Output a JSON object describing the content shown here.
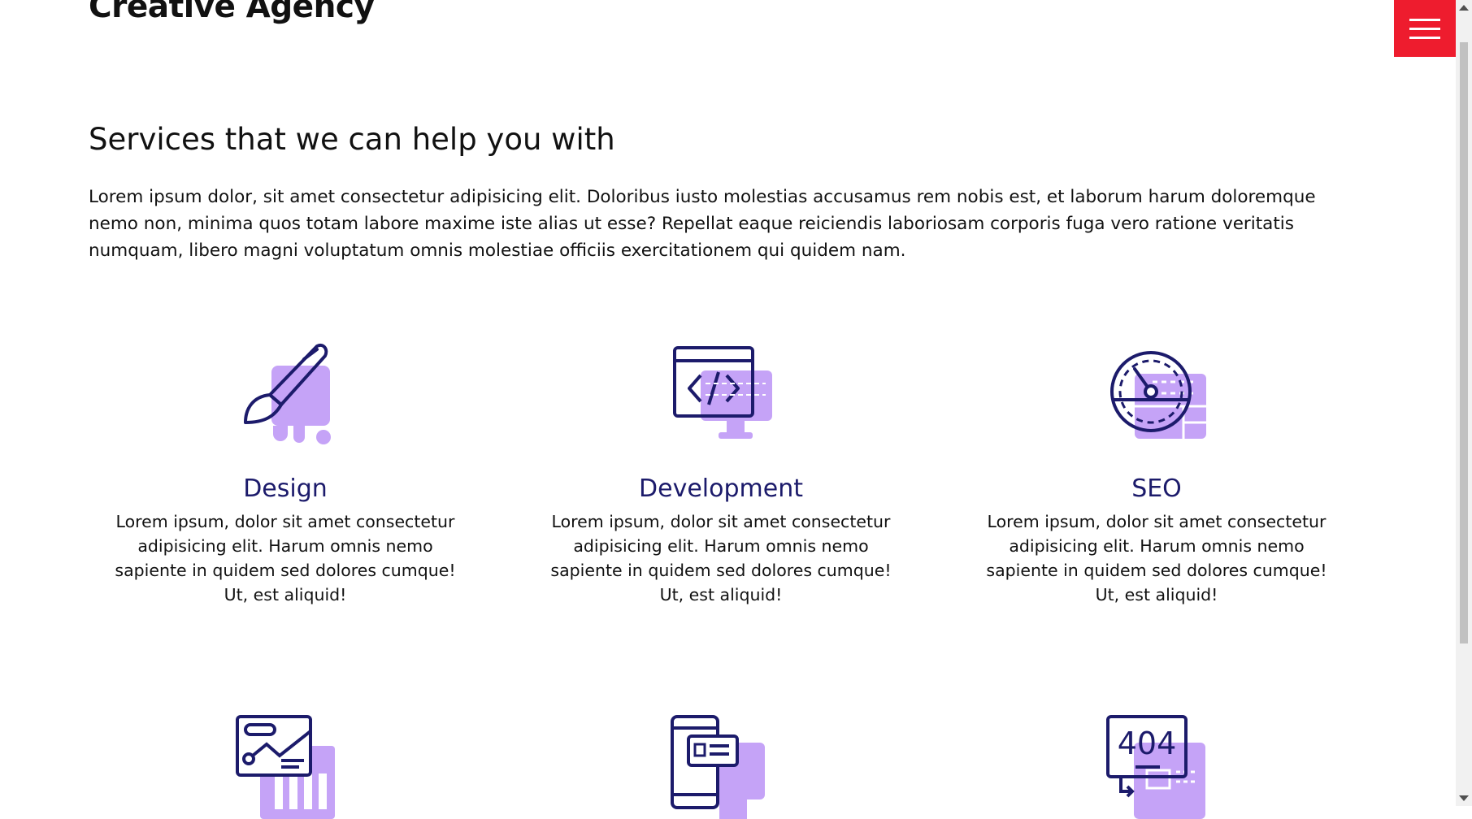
{
  "header": {
    "brand": "Creative Agency",
    "menu_icon": "hamburger-menu-icon",
    "menu_color": "#ee1c2e"
  },
  "intro": {
    "title": "Services that we can help you with",
    "text": "Lorem ipsum dolor, sit amet consectetur adipisicing elit. Doloribus iusto molestias accusamus rem nobis est, et laborum harum doloremque nemo non, minima quos totam labore maxime iste alias ut esse? Repellat eaque reiciendis laboriosam corporis fuga vero ratione veritatis numquam, libero magni voluptatum omnis molestiae officiis exercitationem qui quidem nam."
  },
  "colors": {
    "icon_outline": "#1c1b6b",
    "icon_fill": "#c5a3f7",
    "heading": "#1c1b6b"
  },
  "services": [
    {
      "icon": "paintbrush-icon",
      "title": "Design",
      "text": "Lorem ipsum, dolor sit amet consectetur adipisicing elit. Harum omnis nemo sapiente in quidem sed dolores cumque! Ut, est aliquid!"
    },
    {
      "icon": "code-monitor-icon",
      "title": "Development",
      "text": "Lorem ipsum, dolor sit amet consectetur adipisicing elit. Harum omnis nemo sapiente in quidem sed dolores cumque! Ut, est aliquid!"
    },
    {
      "icon": "speedometer-icon",
      "title": "SEO",
      "text": "Lorem ipsum, dolor sit amet consectetur adipisicing elit. Harum omnis nemo sapiente in quidem sed dolores cumque! Ut, est aliquid!"
    },
    {
      "icon": "analytics-chart-icon"
    },
    {
      "icon": "mobile-app-icon"
    },
    {
      "icon": "error-404-icon",
      "icon_text": "404"
    }
  ]
}
